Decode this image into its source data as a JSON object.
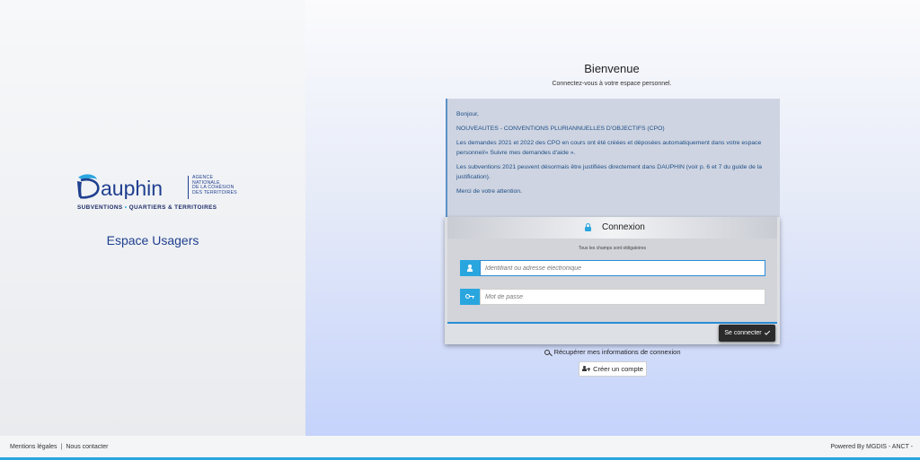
{
  "brand": {
    "logo_text": "Dauphin",
    "agency_lines": [
      "AGENCE",
      "NATIONALE",
      "DE LA COHÉSION",
      "DES TERRITOIRES"
    ],
    "tagline_part1": "SUBVENTIONS",
    "tagline_dot": "•",
    "tagline_part2": "QUARTIERS & TERRITOIRES",
    "space_title": "Espace Usagers",
    "accent_color": "#2aa6df",
    "navy_color": "#1f3f8f"
  },
  "welcome": {
    "title": "Bienvenue",
    "subtitle": "Connectez-vous à votre espace personnel."
  },
  "info": {
    "paragraphs": [
      "Bonjour,",
      "NOUVEAUTES - CONVENTIONS PLURIANNUELLES D'OBJECTIFS (CPO)",
      "Les demandes 2021 et 2022 des CPO en cours ont été créées et déposées automatiquement dans votre espace personnel/« Suivre mes demandes d'aide ».",
      "Les subventions 2021 peuvent désormais être justifiées directement dans DAUPHIN (voir p. 6 et 7 du guide de la justification).",
      "Merci de votre attention."
    ]
  },
  "login": {
    "title": "Connexion",
    "required_note": "Tous les champs sont obligatoires",
    "username_placeholder": "Identifiant ou adresse électronique",
    "password_placeholder": "Mot de passe",
    "submit_label": "Se connecter",
    "icons": {
      "title": "lock-icon",
      "username": "user-icon",
      "password": "key-icon",
      "submit": "check-icon"
    }
  },
  "links": {
    "recover": "Récupérer mes informations de connexion",
    "create_account": "Créer un compte"
  },
  "footer": {
    "legal": "Mentions légales",
    "separator": "|",
    "contact": "Nous contacter",
    "powered": "Powered By MGDIS - ANCT -"
  }
}
